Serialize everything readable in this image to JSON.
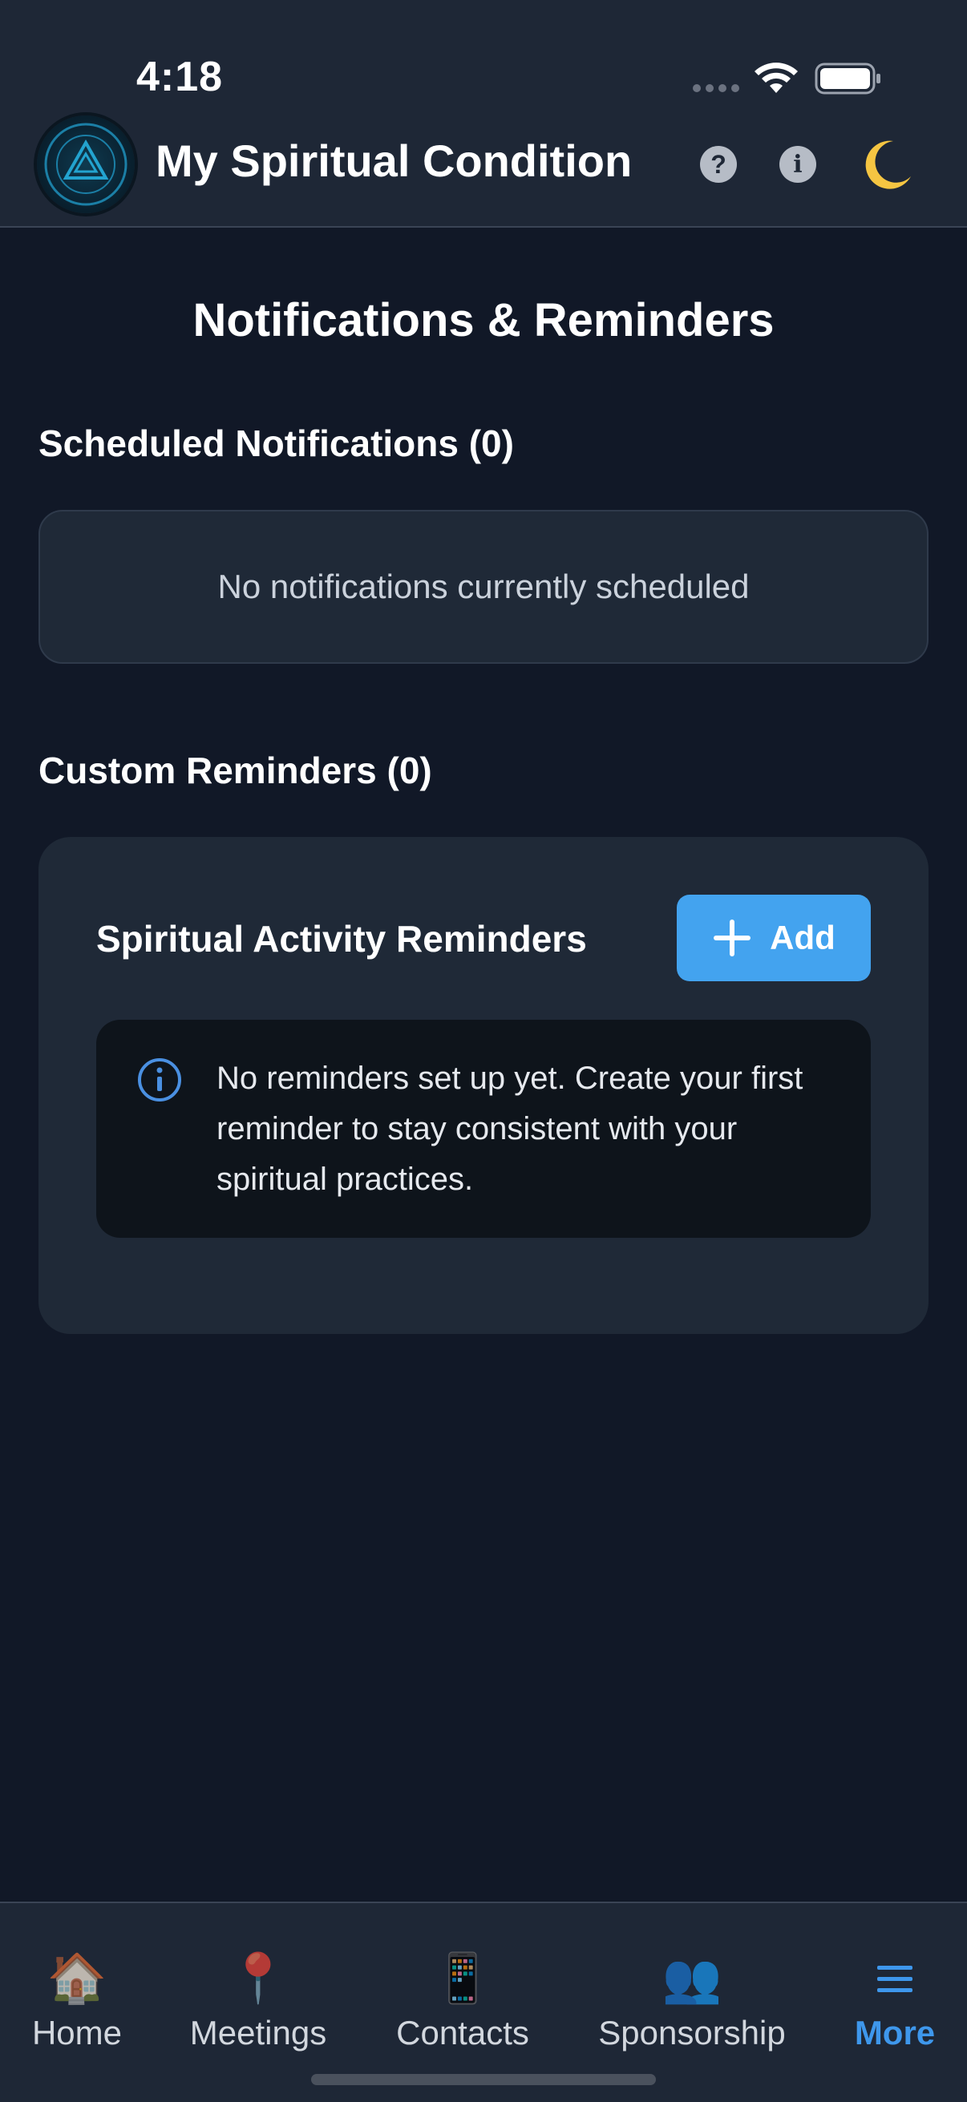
{
  "status_bar": {
    "time": "4:18"
  },
  "header": {
    "app_title": "My Spiritual Condition",
    "logo_icon": "spiritual-condition-tracker-logo",
    "help_icon_glyph": "?",
    "info_icon_glyph": "i",
    "theme_icon": "moon-icon"
  },
  "main": {
    "page_title": "Notifications & Reminders",
    "scheduled": {
      "heading": "Scheduled Notifications (0)",
      "empty_text": "No notifications currently scheduled"
    },
    "custom": {
      "heading": "Custom Reminders (0)",
      "card_title": "Spiritual Activity Reminders",
      "add_label": "Add",
      "info_text": "No reminders set up yet. Create your first reminder to stay consistent with your spiritual practices."
    }
  },
  "bottom_nav": {
    "items": [
      {
        "label": "Home",
        "icon": "🏠"
      },
      {
        "label": "Meetings",
        "icon": "📍"
      },
      {
        "label": "Contacts",
        "icon": "📱"
      },
      {
        "label": "Sponsorship",
        "icon": "👥"
      },
      {
        "label": "More",
        "icon": "menu-icon"
      }
    ],
    "active": "More"
  },
  "colors": {
    "background": "#111827",
    "card": "#1f2937",
    "accent": "#43a3ef",
    "active_nav": "#3e97ec"
  }
}
